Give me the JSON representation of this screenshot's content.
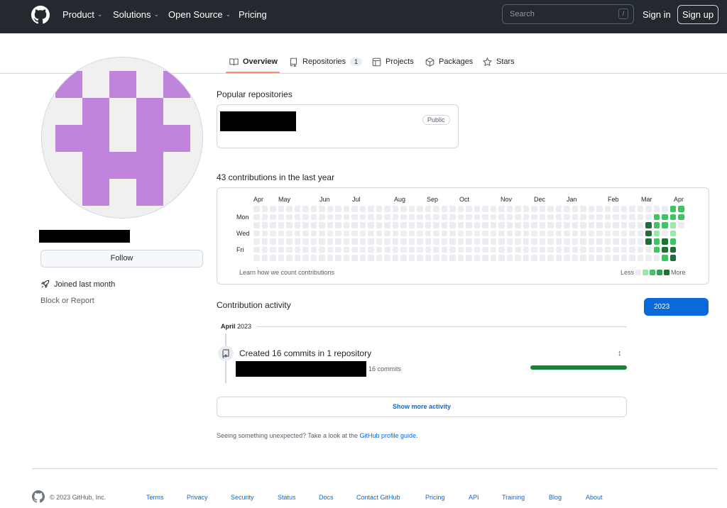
{
  "header": {
    "nav": [
      {
        "label": "Product",
        "has_menu": true
      },
      {
        "label": "Solutions",
        "has_menu": true
      },
      {
        "label": "Open Source",
        "has_menu": true
      },
      {
        "label": "Pricing",
        "has_menu": false
      }
    ],
    "search_placeholder": "Search",
    "search_shortcut": "/",
    "signin": "Sign in",
    "signup": "Sign up"
  },
  "tabs": [
    {
      "label": "Overview",
      "icon": "book-icon",
      "active": true
    },
    {
      "label": "Repositories",
      "icon": "repo-icon",
      "count": "1"
    },
    {
      "label": "Projects",
      "icon": "table-icon"
    },
    {
      "label": "Packages",
      "icon": "package-icon"
    },
    {
      "label": "Stars",
      "icon": "star-icon"
    }
  ],
  "sidebar": {
    "follow": "Follow",
    "joined": "Joined last month",
    "block": "Block or Report"
  },
  "popular": {
    "title": "Popular repositories",
    "badge": "Public"
  },
  "contributions": {
    "title": "43 contributions in the last year",
    "months": [
      "Apr",
      "May",
      "Jun",
      "Jul",
      "Aug",
      "Sep",
      "Oct",
      "Nov",
      "Dec",
      "Jan",
      "Feb",
      "Mar",
      "Apr"
    ],
    "days": [
      "Mon",
      "Wed",
      "Fri"
    ],
    "learn": "Learn how we count contributions",
    "less": "Less",
    "more": "More",
    "colors": {
      "empty": "#ebedf0",
      "l1": "#9be9a8",
      "l2": "#40c463",
      "l3": "#30a14e",
      "l4": "#216e39"
    }
  },
  "activity": {
    "title": "Contribution activity",
    "year": "2023",
    "month": "April",
    "month_year": "2023",
    "created": "Created 16 commits in 1 repository",
    "commits": "16 commits",
    "show_more": "Show more activity",
    "unexpected": "Seeing something unexpected? Take a look at the ",
    "guide_link": "GitHub profile guide",
    "period": "."
  },
  "footer": {
    "copyright": "© 2023 GitHub, Inc.",
    "links": [
      "Terms",
      "Privacy",
      "Security",
      "Status",
      "Docs",
      "Contact GitHub",
      "Pricing",
      "API",
      "Training",
      "Blog",
      "About"
    ]
  }
}
